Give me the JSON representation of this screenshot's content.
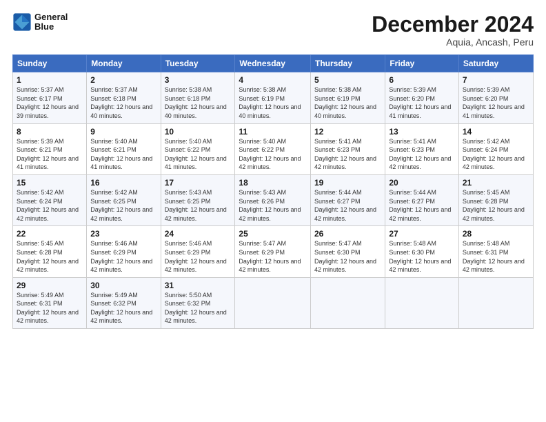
{
  "logo": {
    "line1": "General",
    "line2": "Blue"
  },
  "title": "December 2024",
  "subtitle": "Aquia, Ancash, Peru",
  "days_header": [
    "Sunday",
    "Monday",
    "Tuesday",
    "Wednesday",
    "Thursday",
    "Friday",
    "Saturday"
  ],
  "weeks": [
    [
      {
        "num": "1",
        "sunrise": "5:37 AM",
        "sunset": "6:17 PM",
        "daylight": "12 hours and 39 minutes."
      },
      {
        "num": "2",
        "sunrise": "5:37 AM",
        "sunset": "6:18 PM",
        "daylight": "12 hours and 40 minutes."
      },
      {
        "num": "3",
        "sunrise": "5:38 AM",
        "sunset": "6:18 PM",
        "daylight": "12 hours and 40 minutes."
      },
      {
        "num": "4",
        "sunrise": "5:38 AM",
        "sunset": "6:19 PM",
        "daylight": "12 hours and 40 minutes."
      },
      {
        "num": "5",
        "sunrise": "5:38 AM",
        "sunset": "6:19 PM",
        "daylight": "12 hours and 40 minutes."
      },
      {
        "num": "6",
        "sunrise": "5:39 AM",
        "sunset": "6:20 PM",
        "daylight": "12 hours and 41 minutes."
      },
      {
        "num": "7",
        "sunrise": "5:39 AM",
        "sunset": "6:20 PM",
        "daylight": "12 hours and 41 minutes."
      }
    ],
    [
      {
        "num": "8",
        "sunrise": "5:39 AM",
        "sunset": "6:21 PM",
        "daylight": "12 hours and 41 minutes."
      },
      {
        "num": "9",
        "sunrise": "5:40 AM",
        "sunset": "6:21 PM",
        "daylight": "12 hours and 41 minutes."
      },
      {
        "num": "10",
        "sunrise": "5:40 AM",
        "sunset": "6:22 PM",
        "daylight": "12 hours and 41 minutes."
      },
      {
        "num": "11",
        "sunrise": "5:40 AM",
        "sunset": "6:22 PM",
        "daylight": "12 hours and 42 minutes."
      },
      {
        "num": "12",
        "sunrise": "5:41 AM",
        "sunset": "6:23 PM",
        "daylight": "12 hours and 42 minutes."
      },
      {
        "num": "13",
        "sunrise": "5:41 AM",
        "sunset": "6:23 PM",
        "daylight": "12 hours and 42 minutes."
      },
      {
        "num": "14",
        "sunrise": "5:42 AM",
        "sunset": "6:24 PM",
        "daylight": "12 hours and 42 minutes."
      }
    ],
    [
      {
        "num": "15",
        "sunrise": "5:42 AM",
        "sunset": "6:24 PM",
        "daylight": "12 hours and 42 minutes."
      },
      {
        "num": "16",
        "sunrise": "5:42 AM",
        "sunset": "6:25 PM",
        "daylight": "12 hours and 42 minutes."
      },
      {
        "num": "17",
        "sunrise": "5:43 AM",
        "sunset": "6:25 PM",
        "daylight": "12 hours and 42 minutes."
      },
      {
        "num": "18",
        "sunrise": "5:43 AM",
        "sunset": "6:26 PM",
        "daylight": "12 hours and 42 minutes."
      },
      {
        "num": "19",
        "sunrise": "5:44 AM",
        "sunset": "6:27 PM",
        "daylight": "12 hours and 42 minutes."
      },
      {
        "num": "20",
        "sunrise": "5:44 AM",
        "sunset": "6:27 PM",
        "daylight": "12 hours and 42 minutes."
      },
      {
        "num": "21",
        "sunrise": "5:45 AM",
        "sunset": "6:28 PM",
        "daylight": "12 hours and 42 minutes."
      }
    ],
    [
      {
        "num": "22",
        "sunrise": "5:45 AM",
        "sunset": "6:28 PM",
        "daylight": "12 hours and 42 minutes."
      },
      {
        "num": "23",
        "sunrise": "5:46 AM",
        "sunset": "6:29 PM",
        "daylight": "12 hours and 42 minutes."
      },
      {
        "num": "24",
        "sunrise": "5:46 AM",
        "sunset": "6:29 PM",
        "daylight": "12 hours and 42 minutes."
      },
      {
        "num": "25",
        "sunrise": "5:47 AM",
        "sunset": "6:29 PM",
        "daylight": "12 hours and 42 minutes."
      },
      {
        "num": "26",
        "sunrise": "5:47 AM",
        "sunset": "6:30 PM",
        "daylight": "12 hours and 42 minutes."
      },
      {
        "num": "27",
        "sunrise": "5:48 AM",
        "sunset": "6:30 PM",
        "daylight": "12 hours and 42 minutes."
      },
      {
        "num": "28",
        "sunrise": "5:48 AM",
        "sunset": "6:31 PM",
        "daylight": "12 hours and 42 minutes."
      }
    ],
    [
      {
        "num": "29",
        "sunrise": "5:49 AM",
        "sunset": "6:31 PM",
        "daylight": "12 hours and 42 minutes."
      },
      {
        "num": "30",
        "sunrise": "5:49 AM",
        "sunset": "6:32 PM",
        "daylight": "12 hours and 42 minutes."
      },
      {
        "num": "31",
        "sunrise": "5:50 AM",
        "sunset": "6:32 PM",
        "daylight": "12 hours and 42 minutes."
      },
      null,
      null,
      null,
      null
    ]
  ]
}
